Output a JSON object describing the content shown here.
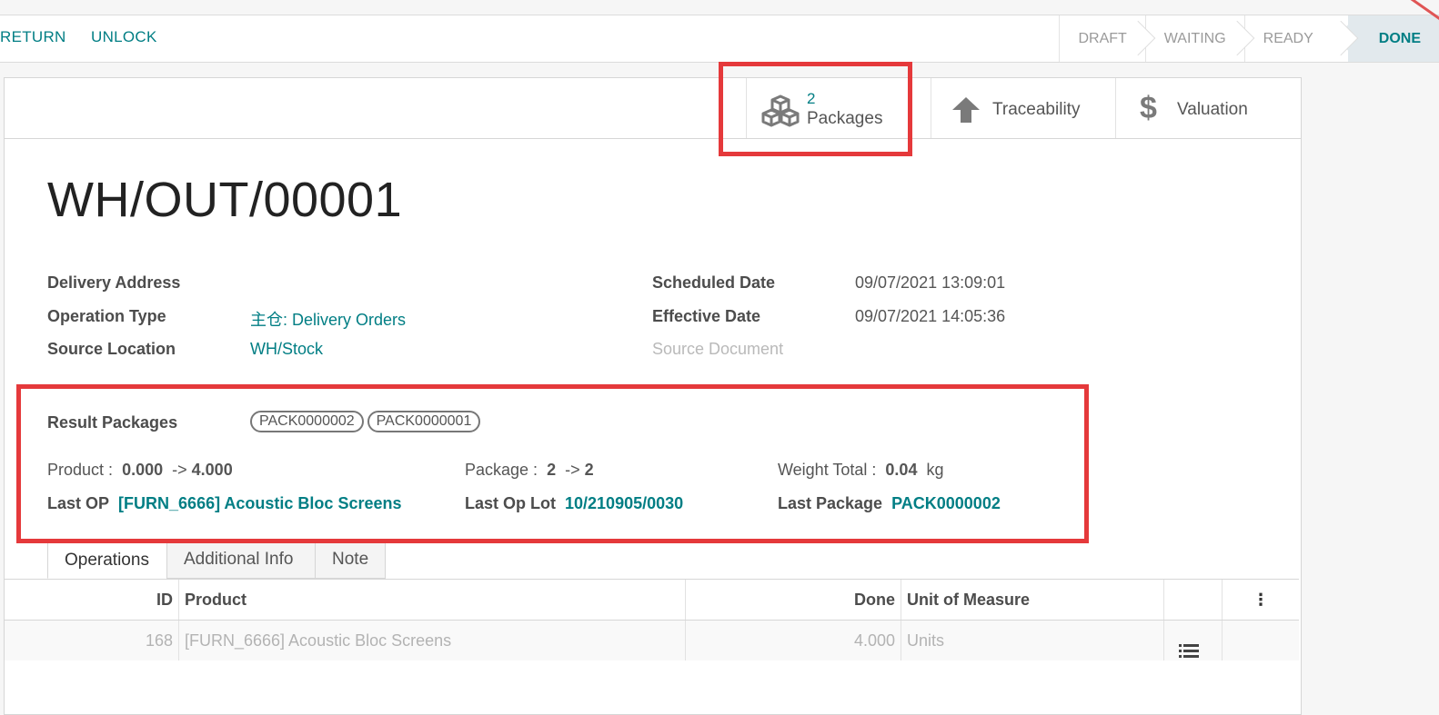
{
  "toolbar": {
    "return_label": "RETURN",
    "unlock_label": "UNLOCK"
  },
  "statusbar": {
    "stages": [
      "DRAFT",
      "WAITING",
      "READY",
      "DONE"
    ],
    "current": "DONE"
  },
  "smart_buttons": {
    "packages": {
      "count": "2",
      "label": "Packages",
      "icon": "cubes-icon"
    },
    "traceability": {
      "label": "Traceability",
      "icon": "arrow-up-icon"
    },
    "valuation": {
      "label": "Valuation",
      "icon": "dollar-icon"
    }
  },
  "record": {
    "name": "WH/OUT/00001",
    "delivery_address_label": "Delivery Address",
    "operation_type_label": "Operation Type",
    "operation_type_value": "主仓: Delivery Orders",
    "source_location_label": "Source Location",
    "source_location_value": "WH/Stock",
    "scheduled_date_label": "Scheduled Date",
    "scheduled_date_value": "09/07/2021 13:09:01",
    "effective_date_label": "Effective Date",
    "effective_date_value": "09/07/2021 14:05:36",
    "source_document_label": "Source Document"
  },
  "packages_section": {
    "result_packages_label": "Result Packages",
    "tags": [
      "PACK0000002",
      "PACK0000001"
    ],
    "product_label": "Product :",
    "product_from": "0.000",
    "product_arrow": "->",
    "product_to": "4.000",
    "package_label": "Package :",
    "package_from": "2",
    "package_arrow": "->",
    "package_to": "2",
    "weight_label": "Weight Total :",
    "weight_value": "0.04",
    "weight_unit": "kg",
    "last_op_label": "Last OP",
    "last_op_value": "[FURN_6666] Acoustic Bloc Screens",
    "last_op_lot_label": "Last Op Lot",
    "last_op_lot_value": "10/210905/0030",
    "last_package_label": "Last Package",
    "last_package_value": "PACK0000002"
  },
  "tabs": [
    "Operations",
    "Additional Info",
    "Note"
  ],
  "active_tab": "Operations",
  "grid": {
    "headers": {
      "id": "ID",
      "product": "Product",
      "done": "Done",
      "uom": "Unit of Measure"
    },
    "rows": [
      {
        "id": "168",
        "product": "[FURN_6666] Acoustic Bloc Screens",
        "done": "4.000",
        "uom": "Units"
      }
    ]
  },
  "colors": {
    "accent": "#017e84",
    "highlight": "#e5393b"
  }
}
